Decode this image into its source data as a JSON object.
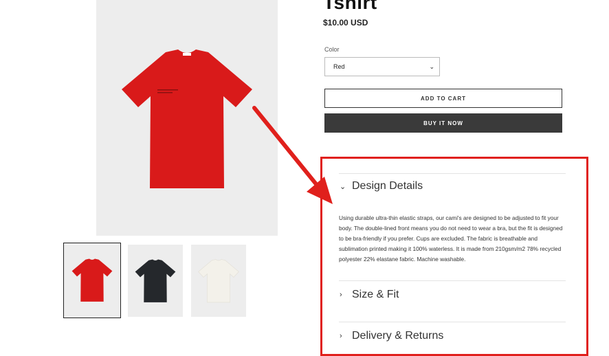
{
  "product": {
    "title": "Tshirt",
    "price": "$10.00 USD"
  },
  "options": {
    "color_label": "Color",
    "color_value": "Red"
  },
  "buttons": {
    "add_to_cart": "ADD TO CART",
    "buy_now": "BUY IT NOW"
  },
  "accordion": {
    "design_details": {
      "title": "Design Details",
      "body": "Using durable ultra-thin elastic straps, our cami's are designed to be adjusted to fit your body. The double-lined front means you do not need to wear a bra, but the fit is designed to be bra-friendly if you prefer. Cups are excluded. The fabric is breathable and sublimation printed making it 100% waterless. It is made from 210gsm/m2 78% recycled polyester 22% elastane fabric. Machine washable."
    },
    "size_fit": {
      "title": "Size & Fit"
    },
    "delivery_returns": {
      "title": "Delivery & Returns"
    }
  },
  "gallery": {
    "thumbnails": [
      {
        "color_name": "red",
        "fill": "#d91a1a"
      },
      {
        "color_name": "black",
        "fill": "#25282c"
      },
      {
        "color_name": "white",
        "fill": "#f3f1ea"
      }
    ]
  },
  "colors": {
    "annotation_red": "#e0201c",
    "buy_button_bg": "#3a3a3a"
  }
}
